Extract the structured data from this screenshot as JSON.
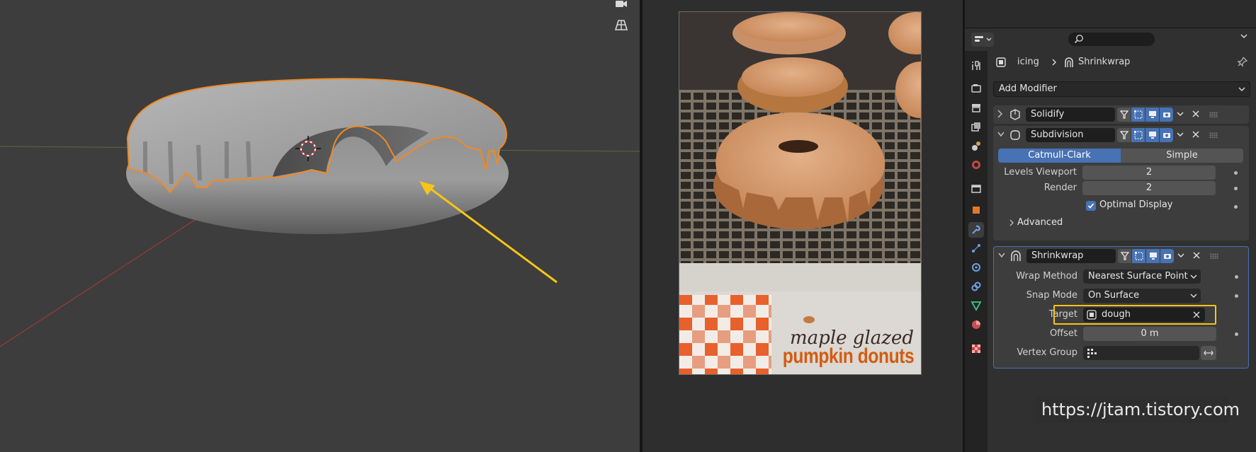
{
  "viewport": {
    "tools": [
      {
        "icon": "camera-icon"
      },
      {
        "icon": "grid-view-icon"
      }
    ],
    "annotation_color": "#f5c518",
    "selection_color": "#f08a24"
  },
  "image_editor": {
    "photo_title_line1": "maple glazed",
    "photo_title_line2": "pumpkin donuts"
  },
  "properties": {
    "header": {
      "editor_icon": "properties-editor-icon",
      "search_icon": "search-icon"
    },
    "breadcrumb": {
      "object": "icing",
      "modifier": "Shrinkwrap"
    },
    "add_modifier_label": "Add Modifier",
    "tabs": [
      "tool-icon",
      "render-icon",
      "output-icon",
      "view-layer-icon",
      "scene-icon",
      "world-icon",
      "collection-icon",
      "object-icon",
      "modifier-icon",
      "particles-icon",
      "physics-icon",
      "constraints-icon",
      "data-icon",
      "material-icon",
      "texture-icon"
    ],
    "active_tab": "modifier-icon",
    "modifiers": [
      {
        "name": "Solidify",
        "expanded": false
      },
      {
        "name": "Subdivision",
        "expanded": true,
        "algorithms": [
          "Catmull-Clark",
          "Simple"
        ],
        "active_algorithm": "Catmull-Clark",
        "levels_viewport_label": "Levels Viewport",
        "levels_viewport": "2",
        "render_label": "Render",
        "render": "2",
        "optimal_display_label": "Optimal Display",
        "optimal_display": true,
        "advanced_label": "Advanced"
      },
      {
        "name": "Shrinkwrap",
        "expanded": true,
        "wrap_method_label": "Wrap Method",
        "wrap_method": "Nearest Surface Point",
        "snap_mode_label": "Snap Mode",
        "snap_mode": "On Surface",
        "target_label": "Target",
        "target": "dough",
        "offset_label": "Offset",
        "offset": "0 m",
        "vertex_group_label": "Vertex Group",
        "vertex_group": ""
      }
    ],
    "accent_color": "#4772b3"
  },
  "watermark": "https://jtam.tistory.com"
}
